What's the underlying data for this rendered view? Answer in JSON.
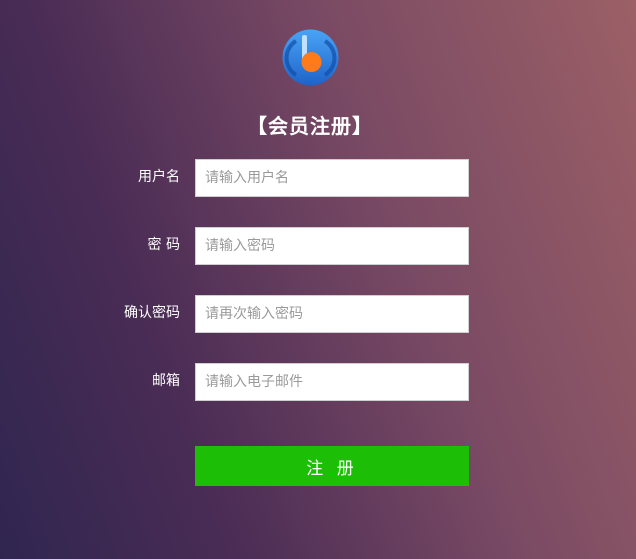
{
  "header": {
    "title": "【会员注册】",
    "logo_icon": "app-logo-icon"
  },
  "form": {
    "fields": [
      {
        "label": "用户名",
        "placeholder": "请输入用户名",
        "value": ""
      },
      {
        "label": "密 码",
        "placeholder": "请输入密码",
        "value": ""
      },
      {
        "label": "确认密码",
        "placeholder": "请再次输入密码",
        "value": ""
      },
      {
        "label": "邮箱",
        "placeholder": "请输入电子邮件",
        "value": ""
      }
    ],
    "submit_label": "注 册"
  },
  "colors": {
    "submit_bg": "#1cbf06",
    "logo_blue": "#2f83e6",
    "logo_orange": "#ff7a18"
  }
}
